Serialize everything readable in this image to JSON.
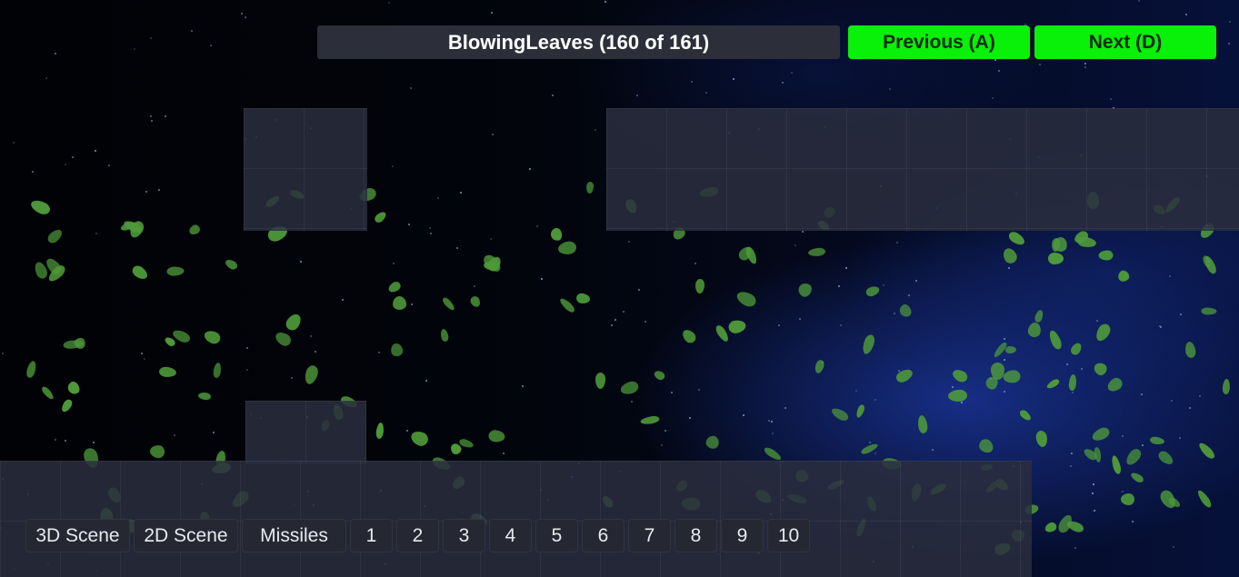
{
  "scene_name": "BlowingLeaves",
  "title": "BlowingLeaves (160 of 161)",
  "navigation": {
    "previous_label": "Previous (A)",
    "next_label": "Next (D)",
    "accent_color": "#09f009"
  },
  "toolbar": {
    "buttons": [
      "3D Scene",
      "2D Scene",
      "Missiles",
      "1",
      "2",
      "3",
      "4",
      "5",
      "6",
      "7",
      "8",
      "9",
      "10"
    ]
  },
  "colors": {
    "leaf": "#4e9a3a",
    "panel": "#2a2e3e",
    "title_bar": "#2c2f3a"
  }
}
